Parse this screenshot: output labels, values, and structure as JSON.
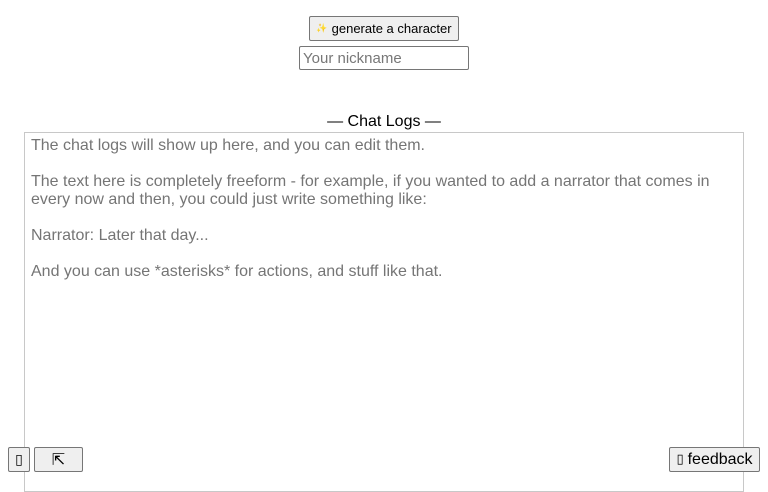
{
  "header": {
    "generate_button": {
      "icon": "sparkle-icon",
      "label": "generate a character"
    },
    "nickname_input": {
      "value": "",
      "placeholder": "Your nickname"
    }
  },
  "chat_logs": {
    "heading": "— Chat Logs —",
    "paragraphs": [
      "The chat logs will show up here, and you can edit them.",
      "The text here is completely freeform - for example, if you wanted to add a narrator that comes in every now and then, you could just write something like:",
      "Narrator: Later that day...",
      "And you can use *asterisks* for actions, and stuff like that."
    ]
  },
  "footer": {
    "left_button_1": {
      "icon": "unknown-glyph-icon",
      "glyph": "▯"
    },
    "left_button_2": {
      "icon": "arrow-up-left-icon",
      "glyph": "⇱"
    },
    "feedback_button": {
      "icon": "feedback-icon",
      "icon_glyph": "▯",
      "label": "feedback"
    }
  }
}
